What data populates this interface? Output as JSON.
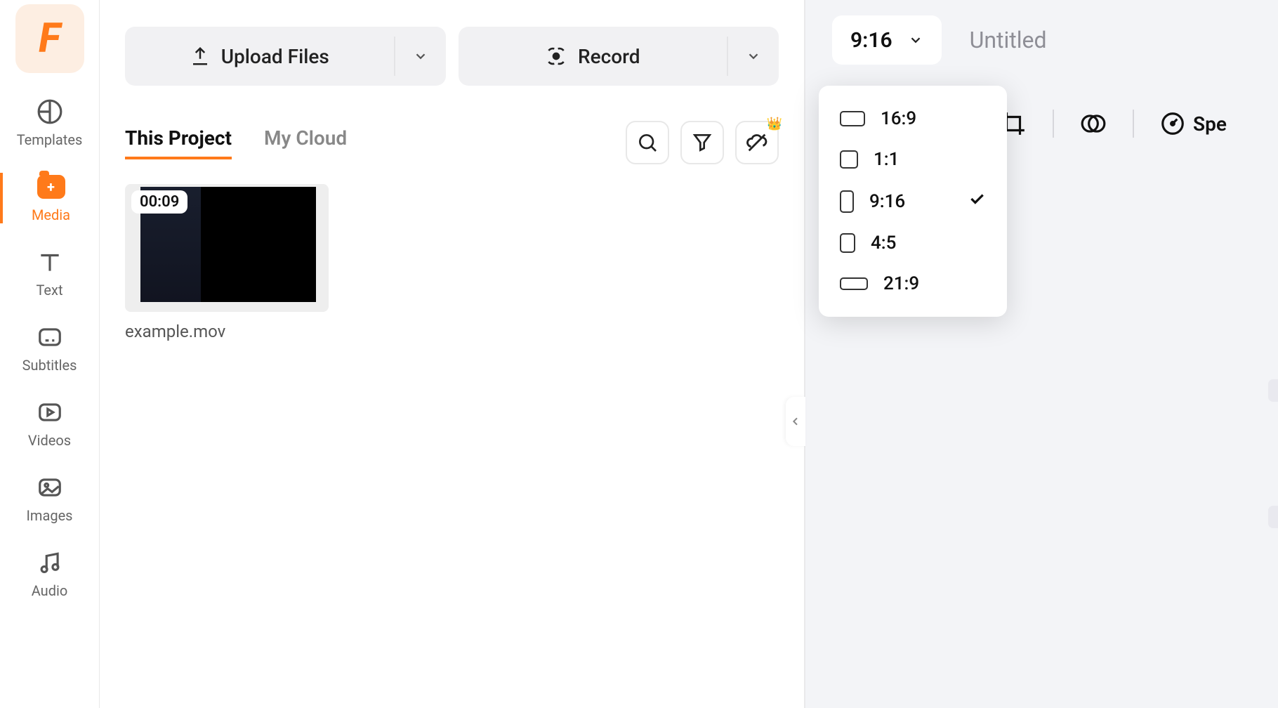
{
  "sidebar": {
    "items": [
      {
        "label": "Templates"
      },
      {
        "label": "Media"
      },
      {
        "label": "Text"
      },
      {
        "label": "Subtitles"
      },
      {
        "label": "Videos"
      },
      {
        "label": "Images"
      },
      {
        "label": "Audio"
      }
    ]
  },
  "topButtons": {
    "upload": "Upload Files",
    "record": "Record"
  },
  "tabs": {
    "thisProject": "This Project",
    "myCloud": "My Cloud"
  },
  "mediaItems": [
    {
      "name": "example.mov",
      "duration": "00:09"
    }
  ],
  "rightPanel": {
    "currentAspect": "9:16",
    "title": "Untitled",
    "speedLabel": "Spe"
  },
  "aspectOptions": [
    {
      "label": "16:9",
      "selected": false,
      "cls": "ratio-16-9"
    },
    {
      "label": "1:1",
      "selected": false,
      "cls": "ratio-1-1"
    },
    {
      "label": "9:16",
      "selected": true,
      "cls": "ratio-9-16"
    },
    {
      "label": "4:5",
      "selected": false,
      "cls": "ratio-4-5"
    },
    {
      "label": "21:9",
      "selected": false,
      "cls": "ratio-21-9"
    }
  ]
}
